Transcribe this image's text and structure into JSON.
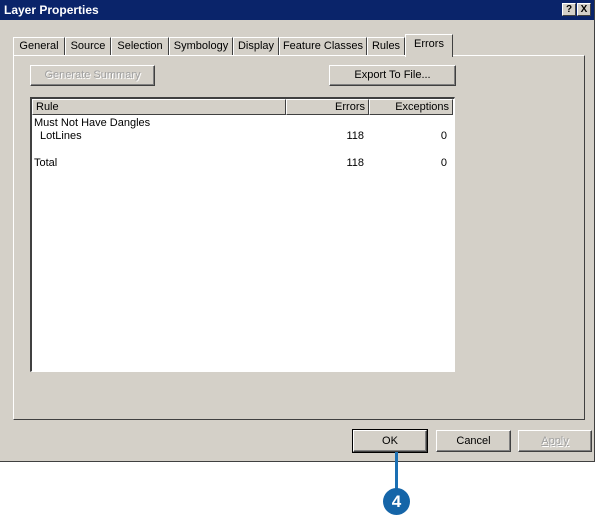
{
  "window": {
    "title": "Layer Properties",
    "help_glyph": "?",
    "close_glyph": "X"
  },
  "tabs": [
    {
      "label": "General"
    },
    {
      "label": "Source"
    },
    {
      "label": "Selection"
    },
    {
      "label": "Symbology"
    },
    {
      "label": "Display"
    },
    {
      "label": "Feature Classes"
    },
    {
      "label": "Rules"
    },
    {
      "label": "Errors",
      "active": true
    }
  ],
  "toolbar": {
    "generate_summary": "Generate Summary",
    "export_to_file": "Export To File..."
  },
  "table": {
    "columns": [
      "Rule",
      "Errors",
      "Exceptions"
    ],
    "rows": [
      {
        "rule": "Must Not Have Dangles",
        "errors": "",
        "exceptions": ""
      },
      {
        "rule": "LotLines",
        "errors": "118",
        "exceptions": "0"
      },
      {
        "rule": "",
        "errors": "",
        "exceptions": ""
      },
      {
        "rule": "Total",
        "errors": "118",
        "exceptions": "0"
      }
    ]
  },
  "footer": {
    "ok": "OK",
    "cancel": "Cancel",
    "apply": "Apply"
  },
  "callout": {
    "step": "4"
  },
  "colors": {
    "titlebar": "#0a246a",
    "dialog_face": "#d4d0c8",
    "callout": "#1565a8"
  }
}
